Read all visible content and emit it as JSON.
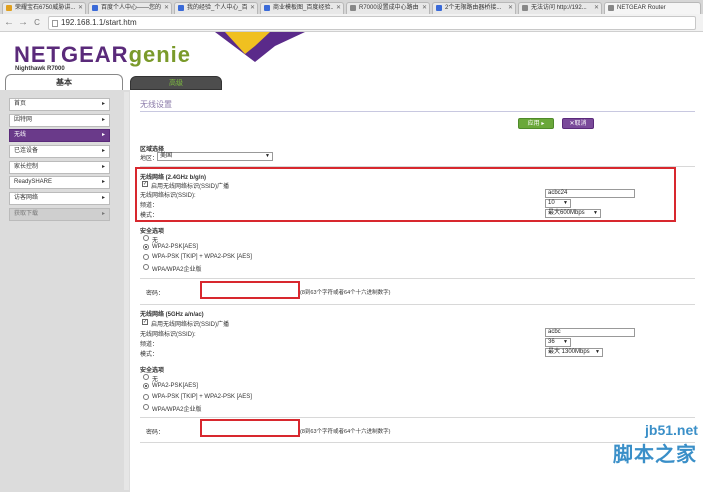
{
  "browser": {
    "tabs": [
      {
        "title": "荣耀宝石6750威胁讲...",
        "color": "#e0a020"
      },
      {
        "title": "百度个人中心——您的...",
        "color": "#3a6ad8"
      },
      {
        "title": "我的经验_个人中心_百...",
        "color": "#3a6ad8"
      },
      {
        "title": "商业模板图_百度经验...",
        "color": "#3a6ad8"
      },
      {
        "title": "R7000设置成中心路由器...",
        "color": "#888888"
      },
      {
        "title": "2个无限路由器桥接...",
        "color": "#3a6ad8"
      },
      {
        "title": "无法访问 http://192...",
        "color": "#888888"
      },
      {
        "title": "NETGEAR Router",
        "color": "#888888"
      }
    ],
    "url": "192.168.1.1/start.htm",
    "back_icon": "←",
    "forward_icon": "→",
    "reload_icon": "C"
  },
  "header": {
    "logo_netgear": "NETGEAR",
    "logo_genie": "genie",
    "model": "Nighthawk R7000",
    "tab_basic": "基本",
    "tab_advanced": "高级"
  },
  "sidebar": {
    "items": [
      {
        "label": "首页",
        "state": "normal"
      },
      {
        "label": "因特网",
        "state": "normal"
      },
      {
        "label": "无线",
        "state": "active"
      },
      {
        "label": "已连设备",
        "state": "normal"
      },
      {
        "label": "家长控制",
        "state": "normal"
      },
      {
        "label": "ReadySHARE",
        "state": "normal"
      },
      {
        "label": "访客网络",
        "state": "normal"
      },
      {
        "label": "获取下载",
        "state": "disabled"
      }
    ],
    "arrow": "▸"
  },
  "main": {
    "title": "无线设置",
    "apply_label": "应用 ▸",
    "cancel_label": "✕取消",
    "region": {
      "title": "区域选择",
      "label": "地区：",
      "value": "美国"
    },
    "band24": {
      "title": "无线网络 (2.4GHz b/g/n)",
      "ssid_broadcast_label": "启用无线网络标识(SSID)广播",
      "ssid_label": "无线网络标识(SSID):",
      "ssid_value": "acbc24",
      "channel_label": "频道：",
      "channel_value": "10",
      "mode_label": "模式：",
      "mode_value": "最大600Mbps"
    },
    "security24": {
      "title": "安全选项",
      "options": [
        "无",
        "WPA2-PSK[AES]",
        "WPA-PSK [TKIP] + WPA2-PSK [AES]",
        "WPA/WPA2企业版"
      ],
      "selected": 1,
      "password_label": "密码：",
      "password_hint": "(8到63个字符或者64个十六进制数字)"
    },
    "band5": {
      "title": "无线网络 (5GHz a/n/ac)",
      "ssid_broadcast_label": "启用无线网络标识(SSID)广播",
      "ssid_label": "无线网络标识(SSID):",
      "ssid_value": "acbc",
      "channel_label": "频道：",
      "channel_value": "36",
      "mode_label": "模式：",
      "mode_value": "最大 1300Mbps"
    },
    "security5": {
      "title": "安全选项",
      "options": [
        "无",
        "WPA2-PSK[AES]",
        "WPA-PSK [TKIP] + WPA2-PSK [AES]",
        "WPA/WPA2企业版"
      ],
      "selected": 1,
      "password_label": "密码：",
      "password_hint": "(8到63个字符或者64个十六进制数字)"
    }
  },
  "watermark": {
    "site": "jb51.net",
    "text": "脚本之家"
  },
  "colors": {
    "accent": "#6a3a8a",
    "highlight_box": "#d8282e",
    "apply": "#6aa83a"
  }
}
